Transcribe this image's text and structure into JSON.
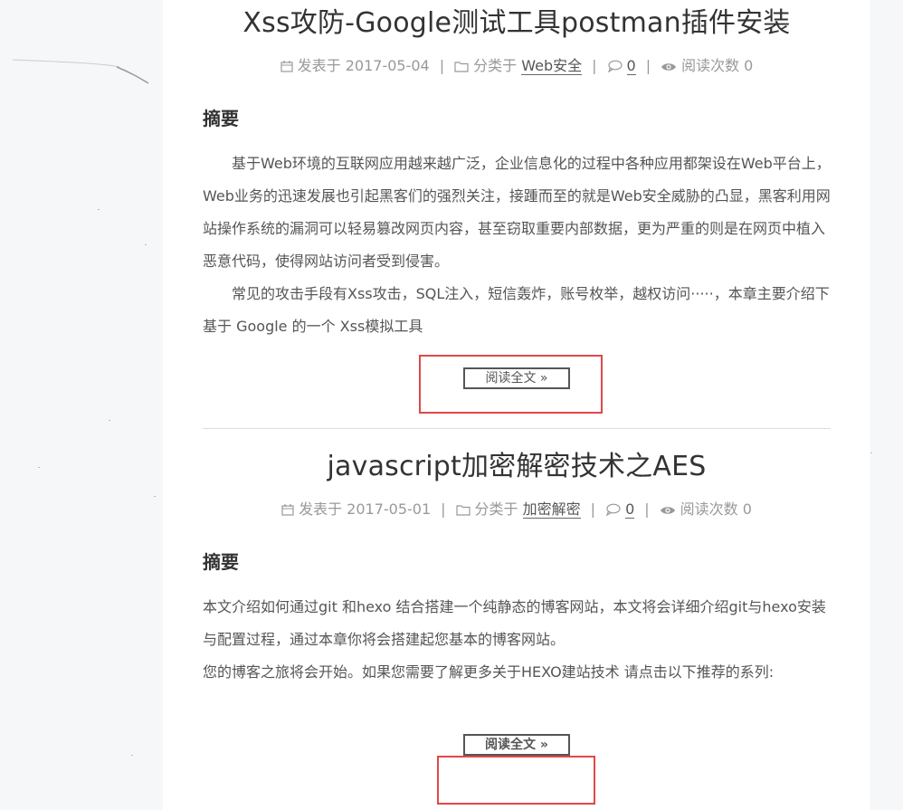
{
  "posts": [
    {
      "title": "Xss攻防-Google测试工具postman插件安装",
      "meta": {
        "posted_label": "发表于 2017-05-04",
        "category_label": "分类于",
        "category": "Web安全",
        "comments": "0",
        "views_label": "阅读次数 0"
      },
      "summary_heading": "摘要",
      "paragraphs": [
        "基于Web环境的互联网应用越来越广泛，企业信息化的过程中各种应用都架设在Web平台上，Web业务的迅速发展也引起黑客们的强烈关注，接踵而至的就是Web安全威胁的凸显，黑客利用网站操作系统的漏洞可以轻易篡改网页内容，甚至窃取重要内部数据，更为严重的则是在网页中植入恶意代码，使得网站访问者受到侵害。",
        "常见的攻击手段有Xss攻击，SQL注入，短信轰炸，账号枚举，越权访问·····，本章主要介绍下基于 Google 的一个 Xss模拟工具"
      ],
      "read_more": "阅读全文 »"
    },
    {
      "title": "javascript加密解密技术之AES",
      "meta": {
        "posted_label": "发表于 2017-05-01",
        "category_label": "分类于",
        "category": "加密解密",
        "comments": "0",
        "views_label": "阅读次数 0"
      },
      "summary_heading": "摘要",
      "paragraphs": [
        "本文介绍如何通过git 和hexo 结合搭建一个纯静态的博客网站，本文将会详细介绍git与hexo安装与配置过程，通过本章你将会搭建起您基本的博客网站。",
        "您的博客之旅将会开始。如果您需要了解更多关于HEXO建站技术 请点击以下推荐的系列:"
      ],
      "read_more": "阅读全文 »"
    }
  ],
  "colors": {
    "highlight": "#e04848",
    "page_bg": "#f5f7f9",
    "content_bg": "#ffffff"
  }
}
